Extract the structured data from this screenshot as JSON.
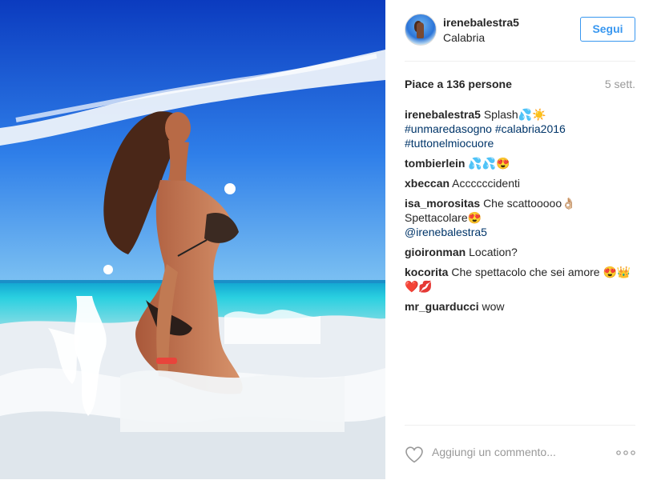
{
  "post": {
    "username": "irenebalestra5",
    "location": "Calabria",
    "follow_label": "Segui",
    "likes": "Piace a 136 persone",
    "time": "5 sett.",
    "caption": {
      "user": "irenebalestra5",
      "text": "Splash💦☀️",
      "tags_line1": "#unmaredasogno #calabria2016",
      "tags_line2": "#tuttonelmiocuore"
    },
    "comments": [
      {
        "user": "tombierlein",
        "text": "💦💦😍"
      },
      {
        "user": "xbeccan",
        "text": "Accccccidenti"
      },
      {
        "user": "isa_morositas",
        "text": "Che scattooooo👌🏼Spettacolare😍",
        "mention": "@irenebalestra5"
      },
      {
        "user": "gioironman",
        "text": "Location?"
      },
      {
        "user": "kocorita",
        "text": "Che spettacolo che sei amore 😍👑❤️💋"
      },
      {
        "user": "mr_guarducci",
        "text": "wow"
      }
    ],
    "add_comment_placeholder": "Aggiungi un commento...",
    "icons": {
      "like": "heart-icon",
      "more": "more-options-icon"
    }
  }
}
